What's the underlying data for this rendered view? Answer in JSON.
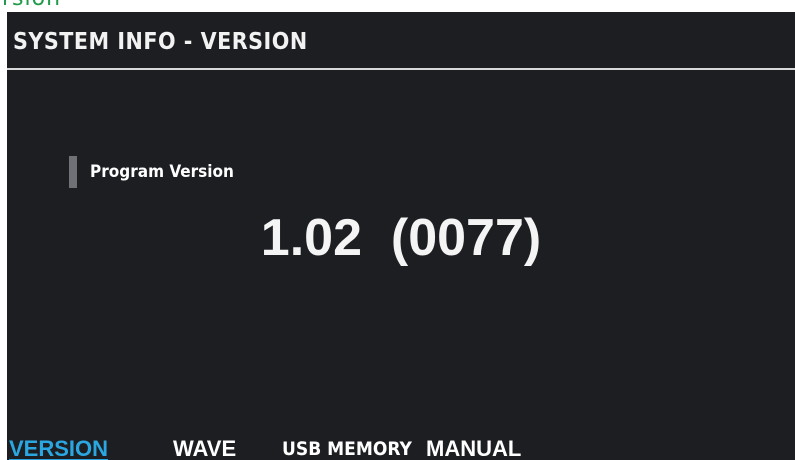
{
  "header": {
    "title": "SYSTEM INFO - VERSION"
  },
  "info": {
    "label": "Program Version",
    "value": "1.02  (0077)"
  },
  "tabs": [
    {
      "label": "VERSION",
      "active": true
    },
    {
      "label": "WAVE",
      "active": false
    },
    {
      "label": "USB MEMORY",
      "active": false
    },
    {
      "label": "MANUAL",
      "active": false
    }
  ],
  "colors": {
    "screen_background": "#1c1e22",
    "active_tab": "#2aa7e0",
    "text": "#f2f2f2"
  }
}
